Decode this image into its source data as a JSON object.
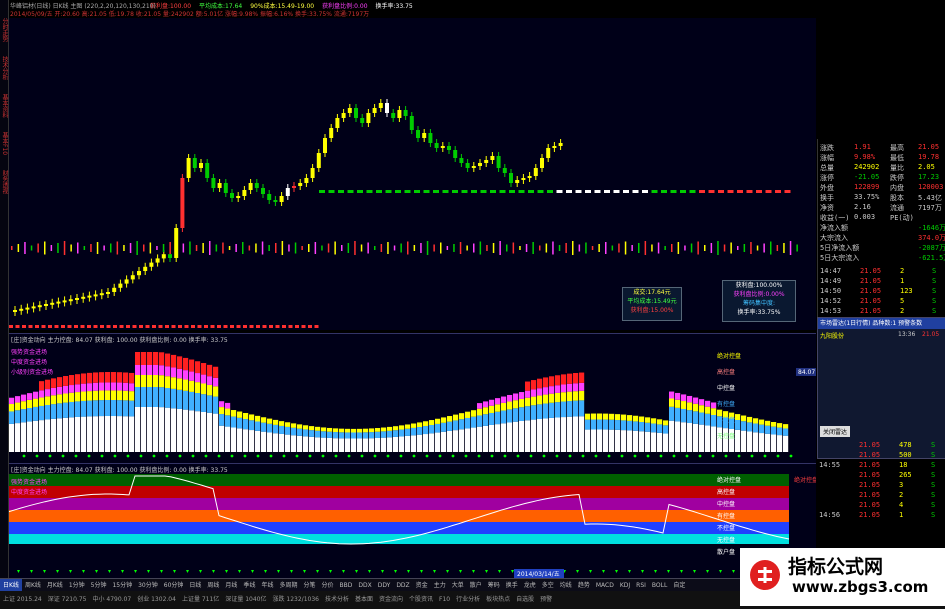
{
  "window": {
    "title": "华峰铝材(日线) 日K线 主图 (220,2,20,120,130,210)"
  },
  "info_line1": {
    "items": [
      {
        "text": "获利盘:100.00",
        "color": "#ff4040"
      },
      {
        "text": "平均成本:17.64",
        "color": "#40ff40"
      },
      {
        "text": "90%成本:15.49-19.00",
        "color": "#ffff40"
      },
      {
        "text": "获利盘比例:0.00",
        "color": "#ff40ff"
      },
      {
        "text": "换手率:33.75",
        "color": "#ffffff"
      }
    ]
  },
  "info_line2": {
    "text": "2014/05/09/五 开:20.60 高:21.05 低:19.78 收:21.05 量:242902 额:5.01亿 涨幅:9.98% 振幅:6.16% 换手:33.75% 流通:7197万"
  },
  "left_vertical_labels": [
    "分时走势",
    "技术分析",
    "基本资料",
    "基本F10",
    "财务透视"
  ],
  "main_chart": {
    "ma_colors": {
      "up": "#ffff00",
      "down": "#00cc00",
      "limit": "#ff3030",
      "flat": "#ffffff"
    },
    "price_axis": [
      "14.00",
      "13.50",
      "13.00"
    ]
  },
  "popups": {
    "left": {
      "lines": [
        "成交:17.64元",
        "平均成本:15.49元",
        "获利盘:15.00%"
      ],
      "colors": [
        "#ffff40",
        "#40ff40",
        "#ff4040"
      ]
    },
    "right": {
      "lines": [
        "获利盘:100.00%",
        "获利盘比例:0.00%",
        "筹码集中度:",
        "换手率:33.75%"
      ],
      "colors": [
        "#ffffff",
        "#ff40ff",
        "#40c0ff",
        "#ffffff"
      ]
    }
  },
  "right_panel": {
    "rows": [
      {
        "l": "涨跌",
        "v1": "1.91",
        "l2": "最高",
        "v2": "21.05",
        "c": "#ff3030"
      },
      {
        "l": "涨幅",
        "v1": "9.98%",
        "l2": "最低",
        "v2": "19.78",
        "c": "#ff3030"
      },
      {
        "l": "总量",
        "v1": "242902",
        "l2": "量比",
        "v2": "2.05",
        "c": "#ffff00"
      },
      {
        "l": "涨停",
        "v1": "-21.05",
        "l2": "跌停",
        "v2": "17.23",
        "c": "#00cc00"
      },
      {
        "l": "外盘",
        "v1": "122899",
        "l2": "内盘",
        "v2": "120003",
        "c": "#ff3030"
      },
      {
        "l": "换手",
        "v1": "33.75%",
        "l2": "股本",
        "v2": "5.43亿",
        "c": "#cccccc"
      },
      {
        "l": "净资",
        "v1": "2.16",
        "l2": "流通",
        "v2": "7197万",
        "c": "#cccccc"
      },
      {
        "l": "收益(一)",
        "v1": "0.003",
        "l2": "PE(动)",
        "v2": "",
        "c": "#cccccc"
      },
      {
        "l": "净流入额",
        "v1": "",
        "l2": "",
        "v2": "-1646万",
        "c": "#00cc00"
      },
      {
        "l": "大宗流入",
        "v1": "",
        "l2": "",
        "v2": "374.0万",
        "c": "#ff3030"
      },
      {
        "l": "5日净流入额",
        "v1": "",
        "l2": "",
        "v2": "-2087万",
        "c": "#00cc00"
      },
      {
        "l": "5日大宗流入",
        "v1": "",
        "l2": "",
        "v2": "-621.5万",
        "c": "#00cc00"
      }
    ],
    "ticks": [
      {
        "t": "14:47",
        "p": "21.05",
        "q": "2",
        "s": "S"
      },
      {
        "t": "14:49",
        "p": "21.05",
        "q": "1",
        "s": "S"
      },
      {
        "t": "14:50",
        "p": "21.05",
        "q": "123",
        "s": "S"
      },
      {
        "t": "14:52",
        "p": "21.05",
        "q": "5",
        "s": "S"
      },
      {
        "t": "14:53",
        "p": "21.05",
        "q": "2",
        "s": "S"
      }
    ],
    "ticks2": [
      {
        "t": "",
        "p": "21.05",
        "q": "478",
        "s": "S"
      },
      {
        "t": "",
        "p": "21.05",
        "q": "500",
        "s": "S"
      },
      {
        "t": "14:55",
        "p": "21.05",
        "q": "18",
        "s": "S"
      },
      {
        "t": "",
        "p": "21.05",
        "q": "265",
        "s": "S"
      },
      {
        "t": "",
        "p": "21.05",
        "q": "3",
        "s": "S"
      },
      {
        "t": "",
        "p": "21.05",
        "q": "2",
        "s": "S"
      },
      {
        "t": "",
        "p": "21.05",
        "q": "4",
        "s": "S"
      },
      {
        "t": "14:56",
        "p": "21.05",
        "q": "1",
        "s": "S"
      }
    ]
  },
  "side_popup": {
    "header": "市场雷达(1日行情) 品种数:1 预警条数",
    "item": "九阳股份",
    "item_time": "13:36",
    "item_val": "21.05",
    "footer": "关闭雷达"
  },
  "indicator1": {
    "title": "[庄]资金动向  主力控盘: 84.07  获利盘: 100.00  获利盘比例: 0.00  换手率: 33.75",
    "notes": [
      "强势资金进场",
      "中度资金进场",
      "小级别资金进场"
    ],
    "zones": [
      "绝对控盘",
      "高控盘",
      "中控盘",
      "有控盘",
      "不控盘",
      "无控盘"
    ],
    "value_label": "84.07"
  },
  "indicator2": {
    "title": "[庄]资金动向  主力控盘: 84.07  获利盘: 100.00  获利盘比例: 0.00  换手率: 33.75",
    "notes": [
      "强势资金进场",
      "中度资金进场"
    ],
    "zones": [
      "绝对控盘",
      "高控盘",
      "中控盘",
      "有控盘",
      "不控盘",
      "无控盘",
      "散户盘"
    ],
    "right_label": "绝对控盘",
    "date_label": "2014/03/14/五"
  },
  "tabbar": {
    "items": [
      "日K线",
      "周K线",
      "月K线",
      "1分钟",
      "5分钟",
      "15分钟",
      "30分钟",
      "60分钟",
      "日线",
      "周线",
      "月线",
      "季线",
      "年线",
      "多周期",
      "分笔",
      "分价",
      "BBD",
      "DDX",
      "DDY",
      "DDZ",
      "资金",
      "主力",
      "大单",
      "散户",
      "筹码",
      "换手",
      "龙虎",
      "多空",
      "均线",
      "趋势",
      "MACD",
      "KDJ",
      "RSI",
      "BOLL",
      "自定"
    ]
  },
  "statusbar": {
    "items": [
      "上证 2015.24",
      "深证 7210.75",
      "中小 4790.07",
      "创业 1302.04",
      "上证量 711亿",
      "深证量 1040亿",
      "涨跌 1232/1036",
      "技术分析",
      "基本面",
      "资金流向",
      "个股资讯",
      "F10",
      "行业分析",
      "板块热点",
      "自选股",
      "预警"
    ]
  },
  "watermark": {
    "title": "指标公式网",
    "url": "www.zbgs3.com"
  }
}
